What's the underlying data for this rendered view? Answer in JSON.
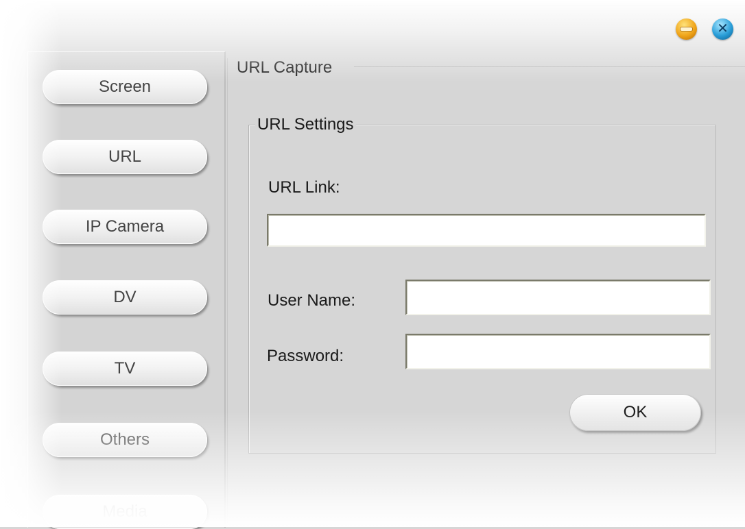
{
  "window": {
    "minimize_icon": "minimize-icon",
    "close_icon": "close-icon",
    "close_glyph": "✕"
  },
  "sidebar": {
    "items": [
      {
        "label": "Screen"
      },
      {
        "label": "URL"
      },
      {
        "label": "IP Camera"
      },
      {
        "label": "DV"
      },
      {
        "label": "TV"
      },
      {
        "label": "Others"
      },
      {
        "label": "Media"
      }
    ]
  },
  "main": {
    "capture_title": "URL Capture",
    "settings": {
      "title": "URL Settings",
      "url_link_label": "URL Link:",
      "url_link_value": "",
      "user_name_label": "User Name:",
      "user_name_value": "",
      "password_label": "Password:",
      "password_value": "",
      "ok_label": "OK"
    }
  },
  "colors": {
    "minimize_accent": "#f0a51a",
    "close_accent": "#2a9ed8",
    "background": "#d6d6d6"
  }
}
